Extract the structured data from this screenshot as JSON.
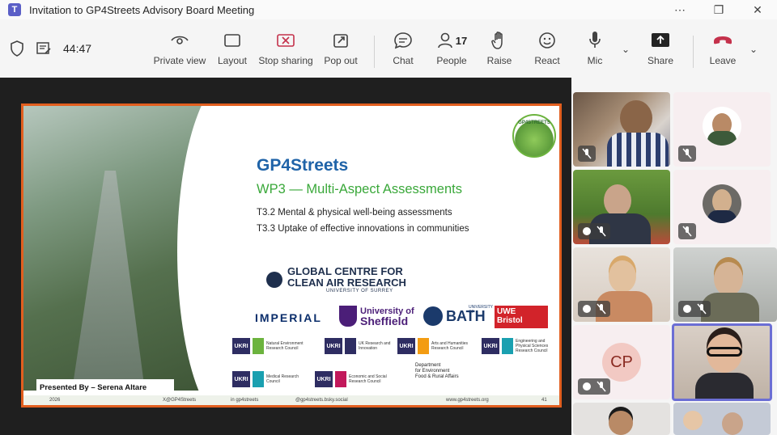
{
  "window": {
    "title": "Invitation to GP4Streets Advisory Board Meeting"
  },
  "toolbar": {
    "timer": "44:47",
    "items": [
      {
        "label": "Private view"
      },
      {
        "label": "Layout"
      },
      {
        "label": "Stop sharing"
      },
      {
        "label": "Pop out"
      },
      {
        "label": "Chat"
      },
      {
        "label": "People"
      },
      {
        "label": "Raise"
      },
      {
        "label": "React"
      },
      {
        "label": "Mic"
      },
      {
        "label": "Share"
      },
      {
        "label": "Leave"
      }
    ],
    "people_count": "17"
  },
  "slide": {
    "title": "GP4Streets",
    "subtitle": "WP3 — Multi-Aspect Assessments",
    "task1": "T3.2 Mental & physical well-being assessments",
    "task2": "T3.3 Uptake of effective innovations in communities",
    "logo_text": "GP4STREETS",
    "gcc_line1": "GLOBAL CENTRE FOR",
    "gcc_line2": "CLEAN AIR RESEARCH",
    "gcc_line3": "UNIVERSITY OF SURREY",
    "imperial": "IMPERIAL",
    "sheffield_1": "University of",
    "sheffield_2": "Sheffield",
    "bath_small": "UNIVERSITY OF",
    "bath": "BATH",
    "uwe_1": "UWE",
    "uwe_2": "Bristol",
    "ukri_1": "Natural Environment Research Council",
    "ukri_2": "UK Research and Innovation",
    "ukri_3": "Arts and Humanities Research Council",
    "ukri_4": "Engineering and Physical Sciences Research Council",
    "ukri_5": "Medical Research Council",
    "ukri_6": "Economic and Social Research Council",
    "ukri_mark": "UKRI",
    "defra_1": "Department",
    "defra_2": "for Environment",
    "defra_3": "Food & Rural Affairs",
    "presented_by": "Presented By – Serena Altare",
    "footer_year": "2026",
    "footer_x": "X@GP4Streets",
    "footer_in": "in gp4streets",
    "footer_bsky": "@gp4streets.bsky.social",
    "footer_web": "www.gp4streets.org",
    "footer_page": "41"
  },
  "participants": {
    "cp_initials": "CP"
  },
  "colors": {
    "accent_orange": "#e25f1f",
    "slide_title_blue": "#1f63a8",
    "slide_sub_green": "#3aa83a",
    "leave_red": "#c4314b",
    "stop_share_red": "#c4314b"
  }
}
